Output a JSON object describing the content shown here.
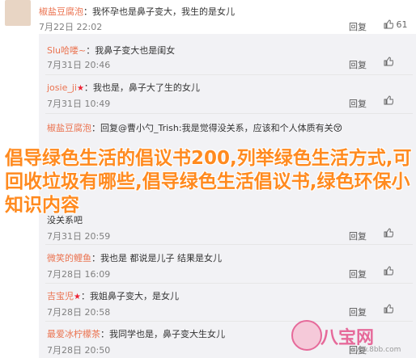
{
  "top": {
    "name": "椒盐豆腐泡",
    "text": "：我怀孕也是鼻子变大，我生的是女儿",
    "time": "7月22日 22:02",
    "reply_label": "回复",
    "like_count": "61"
  },
  "replies": [
    {
      "name": "Slu哈喽~",
      "text": "：我鼻子变大也是闺女",
      "time": "7月31日 20:46",
      "reply_label": "回复"
    },
    {
      "name": "josie_ji",
      "text": "：我也是，鼻子大了生的女儿",
      "time": "7月31日 10:49",
      "reply_label": "回复"
    },
    {
      "name": "椒盐豆腐泡",
      "text": "：回复@曹小勺_Trish:我是觉得没关系，应该和个人体质有关",
      "time": "",
      "reply_label": "回复"
    },
    {
      "name": "",
      "text": "没关系吧",
      "time": "7月31日 20:59",
      "reply_label": "回复"
    },
    {
      "name": "微笑的鲤鱼",
      "text": "：我也是 都说是儿子 结果是女儿",
      "time": "7月28日 16:09",
      "reply_label": "回复"
    },
    {
      "name": "吉宝児",
      "text": "：我姐鼻子变大，是女儿",
      "time": "7月28日 20:58",
      "reply_label": "回复"
    },
    {
      "name": "最爱冰柠檬茶",
      "text": "：我同学也是，鼻子变大生女儿",
      "time": "7月28日 20:50",
      "reply_label": "回复"
    }
  ],
  "overlay_text": "倡导绿色生活的倡议书200,列举绿色生活方式,可回收垃圾有哪些,倡导绿色生活倡议书,绿色环保小知识内容",
  "watermark": {
    "text": "八宝网",
    "sub": "www.8bb.com"
  },
  "colors": {
    "name": "#eb7350",
    "overlay": "#ff8a1f",
    "reply_bg": "#f2f2f5"
  }
}
